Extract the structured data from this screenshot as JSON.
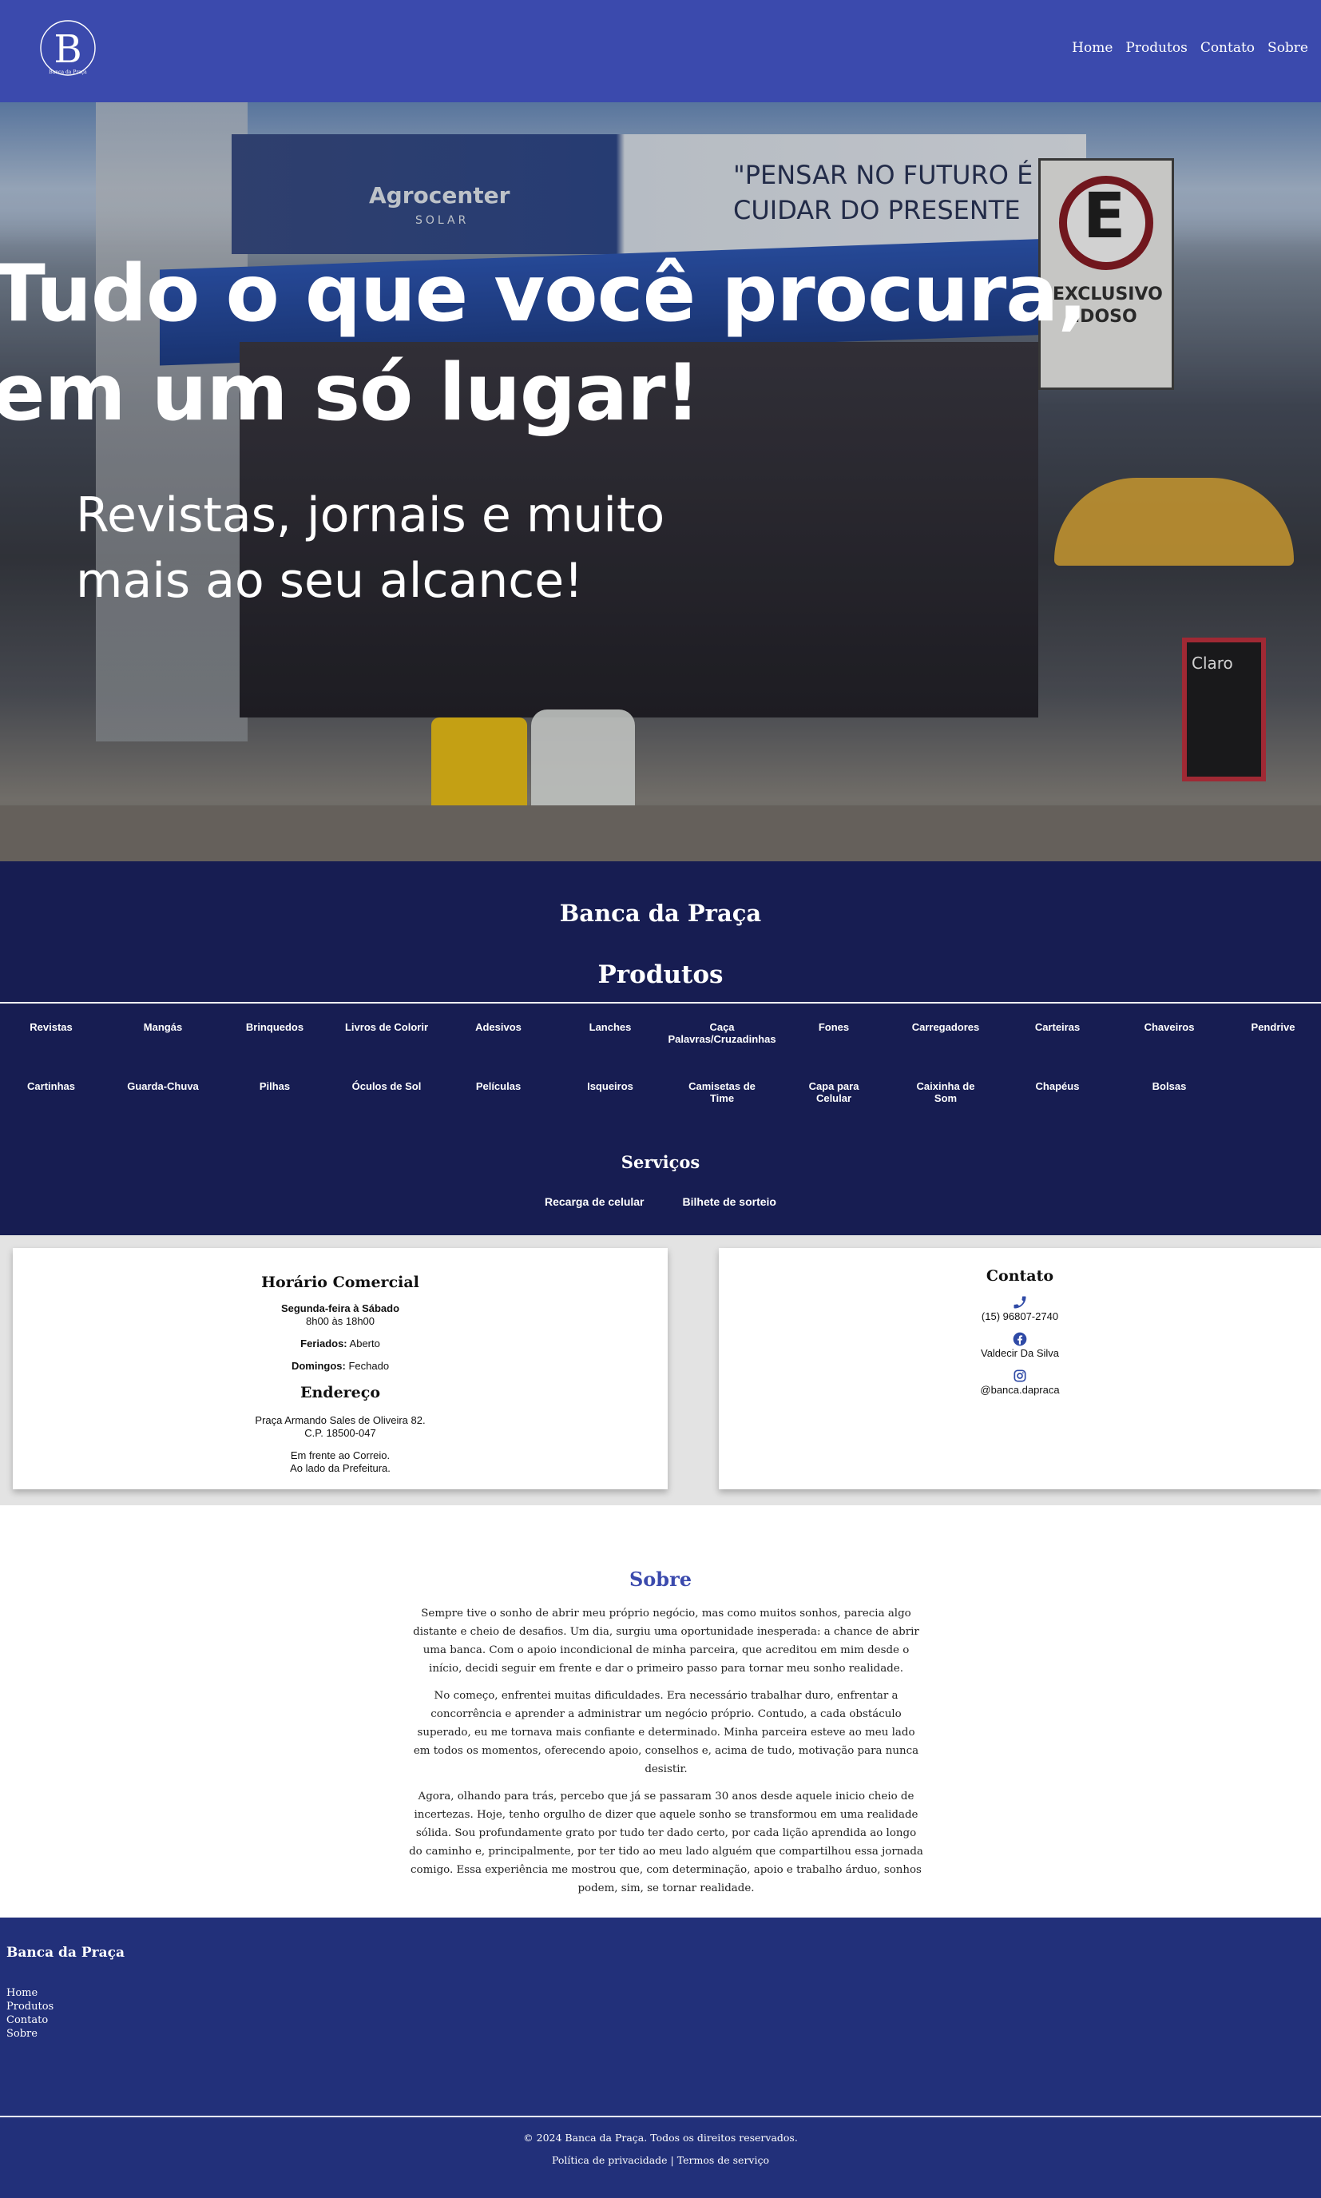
{
  "header": {
    "logo_letter": "B",
    "logo_caption": "Banca da Praça",
    "nav": [
      "Home",
      "Produtos",
      "Contato",
      "Sobre"
    ],
    "color": "#3b4aad"
  },
  "hero": {
    "title_line1": "Tudo o que você procura,",
    "title_line2": "em um só lugar!",
    "subtitle": "Revistas, jornais e muito mais ao seu alcance!",
    "photo_text": {
      "brand": "Agrocenter",
      "brand_sub": "SOLAR",
      "slogan_line1": "\"PENSAR NO FUTURO É",
      "slogan_line2": "CUIDAR DO PRESENTE",
      "sign_letter": "E",
      "sign_line1": "EXCLUSIVO",
      "sign_line2": "IDOSO",
      "chalkboard": "Claro"
    }
  },
  "products_section": {
    "store_name": "Banca da Praça",
    "title": "Produtos",
    "items_row1": [
      "Revistas",
      "Mangás",
      "Brinquedos",
      "Livros de Colorir",
      "Adesivos",
      "Lanches",
      "Caça Palavras/Cruzadinhas",
      "Fones",
      "Carregadores",
      "Carteiras",
      "Chaveiros",
      "Pendrive"
    ],
    "items_row2": [
      "Cartinhas",
      "Guarda-Chuva",
      "Pilhas",
      "Óculos de Sol",
      "Películas",
      "Isqueiros",
      "Camisetas de Time",
      "Capa para Celular",
      "Caixinha de Som",
      "Chapéus",
      "Bolsas"
    ],
    "services_title": "Serviços",
    "services": [
      "Recarga de celular",
      "Bilhete de sorteio"
    ],
    "color": "#171d52"
  },
  "hours": {
    "title": "Horário Comercial",
    "days_label": "Segunda-feira à Sábado",
    "days_hours": "8h00 às 18h00",
    "holidays_label": "Feriados:",
    "holidays_value": "Aberto",
    "sundays_label": "Domingos:",
    "sundays_value": "Fechado",
    "address_title": "Endereço",
    "address_line1": "Praça Armando Sales de Oliveira 82.",
    "address_line2": "C.P. 18500-047",
    "ref_line1": "Em frente ao Correio.",
    "ref_line2": "Ao lado da Prefeitura."
  },
  "contact": {
    "title": "Contato",
    "phone_icon": "phone-icon",
    "phone": "(15) 96807-2740",
    "facebook_icon": "facebook-icon",
    "facebook": "Valdecir Da Silva",
    "instagram_icon": "instagram-icon",
    "instagram": "@banca.dapraca",
    "icon_color": "#2f4aa6"
  },
  "about": {
    "title": "Sobre",
    "paragraphs": [
      "Sempre tive o sonho de abrir meu próprio negócio, mas como muitos sonhos, parecia algo distante e cheio de desafios. Um dia, surgiu uma oportunidade inesperada: a chance de abrir uma banca. Com o apoio incondicional de minha parceira, que acreditou em mim desde o início, decidi seguir em frente e dar o primeiro passo para tornar meu sonho realidade.",
      "No começo, enfrentei muitas dificuldades. Era necessário trabalhar duro, enfrentar a concorrência e aprender a administrar um negócio próprio. Contudo, a cada obstáculo superado, eu me tornava mais confiante e determinado. Minha parceira esteve ao meu lado em todos os momentos, oferecendo apoio, conselhos e, acima de tudo, motivação para nunca desistir.",
      "Agora, olhando para trás, percebo que já se passaram 30 anos desde aquele inicio cheio de incertezas. Hoje, tenho orgulho de dizer que aquele sonho se transformou em uma realidade sólida. Sou profundamente grato por tudo ter dado certo, por cada lição aprendida ao longo do caminho e, principalmente, por ter tido ao meu lado alguém que compartilhou essa jornada comigo. Essa experiência me mostrou que, com determinação, apoio e trabalho árduo, sonhos podem, sim, se tornar realidade."
    ],
    "title_color": "#3b4aad"
  },
  "footer": {
    "name": "Banca da Praça",
    "links": [
      "Home",
      "Produtos",
      "Contato",
      "Sobre"
    ],
    "copyright": "© 2024 Banca da Praça. Todos os direitos reservados.",
    "privacy": "Política de privacidade",
    "separator": "|",
    "terms": "Termos de serviço",
    "color": "#22307a"
  }
}
